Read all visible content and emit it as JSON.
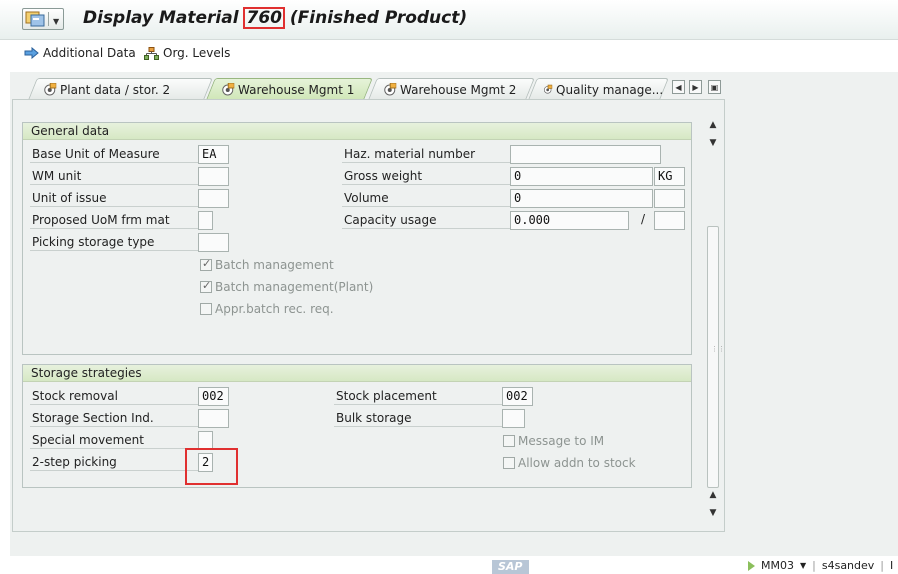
{
  "window": {
    "title_prefix": "Display Material ",
    "material_number": "760",
    "title_suffix": " (Finished Product)"
  },
  "toolbar": {
    "additional_data": "Additional Data",
    "org_levels": "Org. Levels"
  },
  "tabs": [
    {
      "label": "Plant data / stor. 2",
      "active": false
    },
    {
      "label": "Warehouse Mgmt 1",
      "active": true
    },
    {
      "label": "Warehouse Mgmt 2",
      "active": false
    },
    {
      "label": "Quality manage...",
      "active": false
    }
  ],
  "general_data": {
    "title": "General data",
    "base_uom": {
      "label": "Base Unit of Measure",
      "value": "EA"
    },
    "wm_unit": {
      "label": "WM unit",
      "value": ""
    },
    "unit_of_issue": {
      "label": "Unit of issue",
      "value": ""
    },
    "proposed_uom": {
      "label": "Proposed UoM frm mat",
      "value": ""
    },
    "picking_storage_type": {
      "label": "Picking storage type",
      "value": ""
    },
    "haz_material": {
      "label": "Haz. material number",
      "value": ""
    },
    "gross_weight": {
      "label": "Gross weight",
      "value": "0",
      "unit": "KG"
    },
    "volume": {
      "label": "Volume",
      "value": "0",
      "unit": ""
    },
    "capacity_usage": {
      "label": "Capacity usage",
      "value": "0.000",
      "separator": "/",
      "unit": ""
    },
    "batch_management": {
      "label": "Batch management",
      "checked": true
    },
    "batch_management_plant": {
      "label": "Batch management(Plant)",
      "checked": true
    },
    "appr_batch": {
      "label": "Appr.batch rec. req.",
      "checked": false
    }
  },
  "storage_strategies": {
    "title": "Storage strategies",
    "stock_removal": {
      "label": "Stock removal",
      "value": "002"
    },
    "storage_section_ind": {
      "label": "Storage Section Ind.",
      "value": ""
    },
    "special_movement": {
      "label": "Special movement",
      "value": ""
    },
    "two_step_picking": {
      "label": "2-step picking",
      "value": "2"
    },
    "stock_placement": {
      "label": "Stock placement",
      "value": "002"
    },
    "bulk_storage": {
      "label": "Bulk storage",
      "value": ""
    },
    "message_to_im": {
      "label": "Message to IM",
      "checked": false
    },
    "allow_addn_to_stock": {
      "label": "Allow addn to stock",
      "checked": false
    }
  },
  "status_bar": {
    "brand": "SAP",
    "transaction": "MM03",
    "system": "s4sandev",
    "extra": "I"
  },
  "colors": {
    "highlight": "#e03030",
    "active_tab": "#cfe6b7",
    "group_header": "#d6e8c4"
  }
}
